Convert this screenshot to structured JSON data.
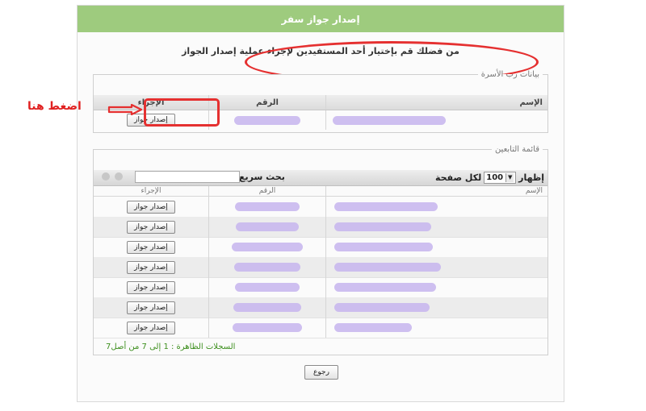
{
  "header": {
    "title": "إصدار جواز سفر"
  },
  "notice": "من فضلك قم بإختيار أحد المستفيدين لإجراء عملية إصدار الجواز",
  "family_head": {
    "legend": "بيانات رب الأسرة",
    "columns": {
      "name": "الإسم",
      "number": "الرقم",
      "action": "الإجراء"
    },
    "action_label": "إصدار جواز"
  },
  "annotation": {
    "text": "اضغط هنا"
  },
  "dependents": {
    "legend": "قائمة التابعين",
    "toolbar": {
      "show_label": "إظهار",
      "page_size": "100",
      "per_page_label": "لكل صفحة",
      "quick_search_label": "بحث سريع",
      "search_placeholder": ""
    },
    "columns": {
      "name": "الإسم",
      "number": "الرقم",
      "action": "الإجراء"
    },
    "rows": [
      {
        "action": "إصدار جواز"
      },
      {
        "action": "إصدار جواز"
      },
      {
        "action": "إصدار جواز"
      },
      {
        "action": "إصدار جواز"
      },
      {
        "action": "إصدار جواز"
      },
      {
        "action": "إصدار جواز"
      },
      {
        "action": "إصدار جواز"
      }
    ],
    "footer": "السجلات الظاهرة : 1 إلى 7 من أصل7"
  },
  "back_button": "رجوع",
  "colors": {
    "header_bg": "#9ecb7e",
    "annotation_red": "#e53030",
    "footer_green": "#3d8f1e",
    "redacted": "#c9b8ee"
  }
}
